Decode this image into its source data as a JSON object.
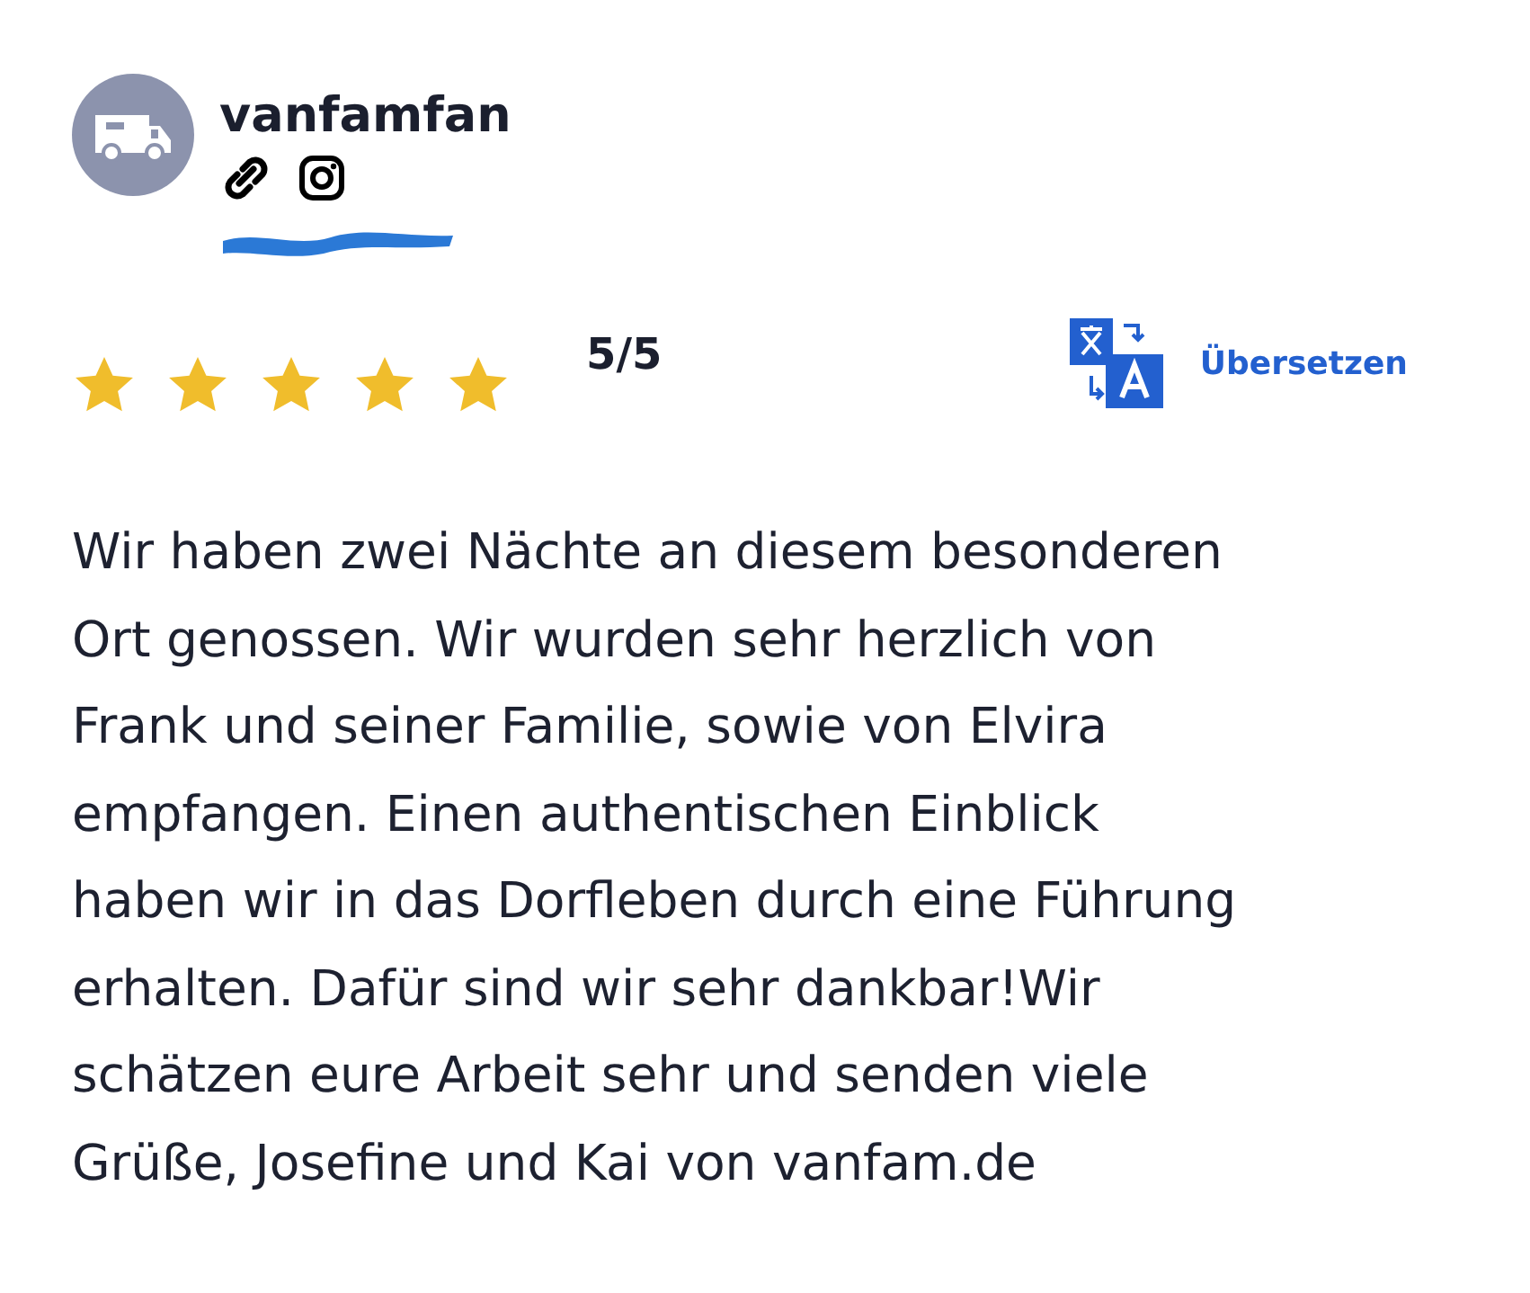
{
  "review": {
    "username": "vanfamfan",
    "stars": 5,
    "rating": "5/5",
    "translate_link": "Übersetzen",
    "text": "Wir haben zwei Nächte an diesem besonderen\nOrt genossen. Wir wurden sehr herzlich von\nFrank und seiner Familie, sowie von Elvira\nempfangen. Einen authentischen Einblick\nhaben wir in das Dorfleben durch eine Führung\nerhalten. Dafür sind wir sehr dankbar!Wir\nschätzen eure Arbeit sehr und senden viele\nGrüße, Josefine und Kai von vanfam.de"
  }
}
